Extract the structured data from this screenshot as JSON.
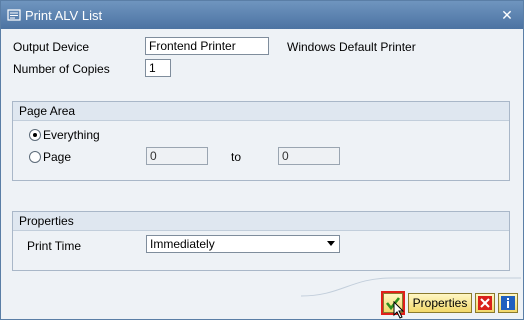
{
  "window": {
    "title": "Print ALV List",
    "icons": {
      "title": "print-list-icon",
      "close": "close-icon"
    }
  },
  "top_fields": {
    "output_device": {
      "label": "Output Device",
      "value": "Frontend Printer",
      "note": "Windows Default Printer"
    },
    "number_of_copies": {
      "label": "Number of Copies",
      "value": "1"
    }
  },
  "page_area": {
    "title": "Page Area",
    "everything_label": "Everything",
    "page_label": "Page",
    "from_value": "0",
    "to_label": "to",
    "to_value": "0",
    "selected": "Everything"
  },
  "properties": {
    "title": "Properties",
    "print_time_label": "Print Time",
    "print_time_value": "Immediately"
  },
  "footer": {
    "properties_button_label": "Properties",
    "icons": {
      "confirm": "check-icon",
      "cancel": "cancel-icon",
      "info": "info-icon"
    }
  },
  "colors": {
    "titlebar": "#4c73a2",
    "button_fill": "#f2d86a",
    "focus": "#e0201b",
    "cancel": "#d9201a",
    "confirm": "#2f8f1f",
    "info": "#1f5fbf"
  }
}
